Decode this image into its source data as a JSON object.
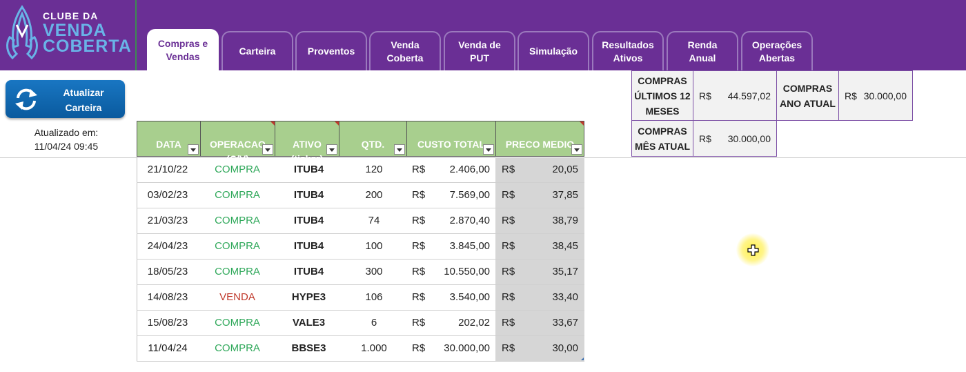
{
  "logo": {
    "line1": "CLUBE DA",
    "line2": "VENDA",
    "line3": "COBERTA"
  },
  "tabs": [
    {
      "label": "Compras e\nVendas",
      "active": true
    },
    {
      "label": "Carteira"
    },
    {
      "label": "Proventos"
    },
    {
      "label": "Venda\nCoberta"
    },
    {
      "label": "Venda de\nPUT"
    },
    {
      "label": "Simulação"
    },
    {
      "label": "Resultados\nAtivos"
    },
    {
      "label": "Renda\nAnual"
    },
    {
      "label": "Operações\nAbertas"
    }
  ],
  "refresh": {
    "label": "Atualizar\nCarteira",
    "icon": "refresh-icon"
  },
  "updated": {
    "label": "Atualizado em:",
    "timestamp": "11/04/24 09:45"
  },
  "summary": {
    "last12": {
      "label": "COMPRAS\nÚLTIMOS 12\nMESES",
      "currency": "R$",
      "value": "44.597,02"
    },
    "year": {
      "label": "COMPRAS\nANO ATUAL",
      "currency": "R$",
      "value": "30.000,00"
    },
    "month": {
      "label": "COMPRAS\nMÊS ATUAL",
      "currency": "R$",
      "value": "30.000,00"
    }
  },
  "table": {
    "headers": [
      "DATA",
      "OPERACAO\n(C/V)",
      "ATIVO\n(ticker)",
      "QTD.",
      "CUSTO TOTAL",
      "PRECO MEDIO"
    ],
    "currency": "R$",
    "rows": [
      {
        "date": "21/10/22",
        "op": "COMPRA",
        "ativo": "ITUB4",
        "qtd": "120",
        "total": "2.406,00",
        "pm": "20,05"
      },
      {
        "date": "03/02/23",
        "op": "COMPRA",
        "ativo": "ITUB4",
        "qtd": "200",
        "total": "7.569,00",
        "pm": "37,85"
      },
      {
        "date": "21/03/23",
        "op": "COMPRA",
        "ativo": "ITUB4",
        "qtd": "74",
        "total": "2.870,40",
        "pm": "38,79"
      },
      {
        "date": "24/04/23",
        "op": "COMPRA",
        "ativo": "ITUB4",
        "qtd": "100",
        "total": "3.845,00",
        "pm": "38,45"
      },
      {
        "date": "18/05/23",
        "op": "COMPRA",
        "ativo": "ITUB4",
        "qtd": "300",
        "total": "10.550,00",
        "pm": "35,17"
      },
      {
        "date": "14/08/23",
        "op": "VENDA",
        "ativo": "HYPE3",
        "qtd": "106",
        "total": "3.540,00",
        "pm": "33,40"
      },
      {
        "date": "15/08/23",
        "op": "COMPRA",
        "ativo": "VALE3",
        "qtd": "6",
        "total": "202,02",
        "pm": "33,67"
      },
      {
        "date": "11/04/24",
        "op": "COMPRA",
        "ativo": "BBSE3",
        "qtd": "1.000",
        "total": "30.000,00",
        "pm": "30,00"
      }
    ]
  },
  "colors": {
    "header_purple": "#6a2f95",
    "logo_blue": "#69b3e7",
    "table_header_green": "#a8cf8e",
    "compra_green": "#2fa85a",
    "venda_red": "#c0392b"
  }
}
